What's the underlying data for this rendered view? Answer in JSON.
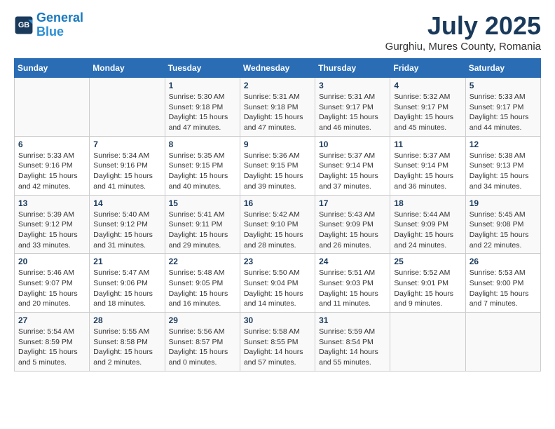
{
  "logo": {
    "line1": "General",
    "line2": "Blue"
  },
  "title": "July 2025",
  "subtitle": "Gurghiu, Mures County, Romania",
  "days_of_week": [
    "Sunday",
    "Monday",
    "Tuesday",
    "Wednesday",
    "Thursday",
    "Friday",
    "Saturday"
  ],
  "weeks": [
    [
      {
        "day": "",
        "info": ""
      },
      {
        "day": "",
        "info": ""
      },
      {
        "day": "1",
        "info": "Sunrise: 5:30 AM\nSunset: 9:18 PM\nDaylight: 15 hours and 47 minutes."
      },
      {
        "day": "2",
        "info": "Sunrise: 5:31 AM\nSunset: 9:18 PM\nDaylight: 15 hours and 47 minutes."
      },
      {
        "day": "3",
        "info": "Sunrise: 5:31 AM\nSunset: 9:17 PM\nDaylight: 15 hours and 46 minutes."
      },
      {
        "day": "4",
        "info": "Sunrise: 5:32 AM\nSunset: 9:17 PM\nDaylight: 15 hours and 45 minutes."
      },
      {
        "day": "5",
        "info": "Sunrise: 5:33 AM\nSunset: 9:17 PM\nDaylight: 15 hours and 44 minutes."
      }
    ],
    [
      {
        "day": "6",
        "info": "Sunrise: 5:33 AM\nSunset: 9:16 PM\nDaylight: 15 hours and 42 minutes."
      },
      {
        "day": "7",
        "info": "Sunrise: 5:34 AM\nSunset: 9:16 PM\nDaylight: 15 hours and 41 minutes."
      },
      {
        "day": "8",
        "info": "Sunrise: 5:35 AM\nSunset: 9:15 PM\nDaylight: 15 hours and 40 minutes."
      },
      {
        "day": "9",
        "info": "Sunrise: 5:36 AM\nSunset: 9:15 PM\nDaylight: 15 hours and 39 minutes."
      },
      {
        "day": "10",
        "info": "Sunrise: 5:37 AM\nSunset: 9:14 PM\nDaylight: 15 hours and 37 minutes."
      },
      {
        "day": "11",
        "info": "Sunrise: 5:37 AM\nSunset: 9:14 PM\nDaylight: 15 hours and 36 minutes."
      },
      {
        "day": "12",
        "info": "Sunrise: 5:38 AM\nSunset: 9:13 PM\nDaylight: 15 hours and 34 minutes."
      }
    ],
    [
      {
        "day": "13",
        "info": "Sunrise: 5:39 AM\nSunset: 9:12 PM\nDaylight: 15 hours and 33 minutes."
      },
      {
        "day": "14",
        "info": "Sunrise: 5:40 AM\nSunset: 9:12 PM\nDaylight: 15 hours and 31 minutes."
      },
      {
        "day": "15",
        "info": "Sunrise: 5:41 AM\nSunset: 9:11 PM\nDaylight: 15 hours and 29 minutes."
      },
      {
        "day": "16",
        "info": "Sunrise: 5:42 AM\nSunset: 9:10 PM\nDaylight: 15 hours and 28 minutes."
      },
      {
        "day": "17",
        "info": "Sunrise: 5:43 AM\nSunset: 9:09 PM\nDaylight: 15 hours and 26 minutes."
      },
      {
        "day": "18",
        "info": "Sunrise: 5:44 AM\nSunset: 9:09 PM\nDaylight: 15 hours and 24 minutes."
      },
      {
        "day": "19",
        "info": "Sunrise: 5:45 AM\nSunset: 9:08 PM\nDaylight: 15 hours and 22 minutes."
      }
    ],
    [
      {
        "day": "20",
        "info": "Sunrise: 5:46 AM\nSunset: 9:07 PM\nDaylight: 15 hours and 20 minutes."
      },
      {
        "day": "21",
        "info": "Sunrise: 5:47 AM\nSunset: 9:06 PM\nDaylight: 15 hours and 18 minutes."
      },
      {
        "day": "22",
        "info": "Sunrise: 5:48 AM\nSunset: 9:05 PM\nDaylight: 15 hours and 16 minutes."
      },
      {
        "day": "23",
        "info": "Sunrise: 5:50 AM\nSunset: 9:04 PM\nDaylight: 15 hours and 14 minutes."
      },
      {
        "day": "24",
        "info": "Sunrise: 5:51 AM\nSunset: 9:03 PM\nDaylight: 15 hours and 11 minutes."
      },
      {
        "day": "25",
        "info": "Sunrise: 5:52 AM\nSunset: 9:01 PM\nDaylight: 15 hours and 9 minutes."
      },
      {
        "day": "26",
        "info": "Sunrise: 5:53 AM\nSunset: 9:00 PM\nDaylight: 15 hours and 7 minutes."
      }
    ],
    [
      {
        "day": "27",
        "info": "Sunrise: 5:54 AM\nSunset: 8:59 PM\nDaylight: 15 hours and 5 minutes."
      },
      {
        "day": "28",
        "info": "Sunrise: 5:55 AM\nSunset: 8:58 PM\nDaylight: 15 hours and 2 minutes."
      },
      {
        "day": "29",
        "info": "Sunrise: 5:56 AM\nSunset: 8:57 PM\nDaylight: 15 hours and 0 minutes."
      },
      {
        "day": "30",
        "info": "Sunrise: 5:58 AM\nSunset: 8:55 PM\nDaylight: 14 hours and 57 minutes."
      },
      {
        "day": "31",
        "info": "Sunrise: 5:59 AM\nSunset: 8:54 PM\nDaylight: 14 hours and 55 minutes."
      },
      {
        "day": "",
        "info": ""
      },
      {
        "day": "",
        "info": ""
      }
    ]
  ]
}
